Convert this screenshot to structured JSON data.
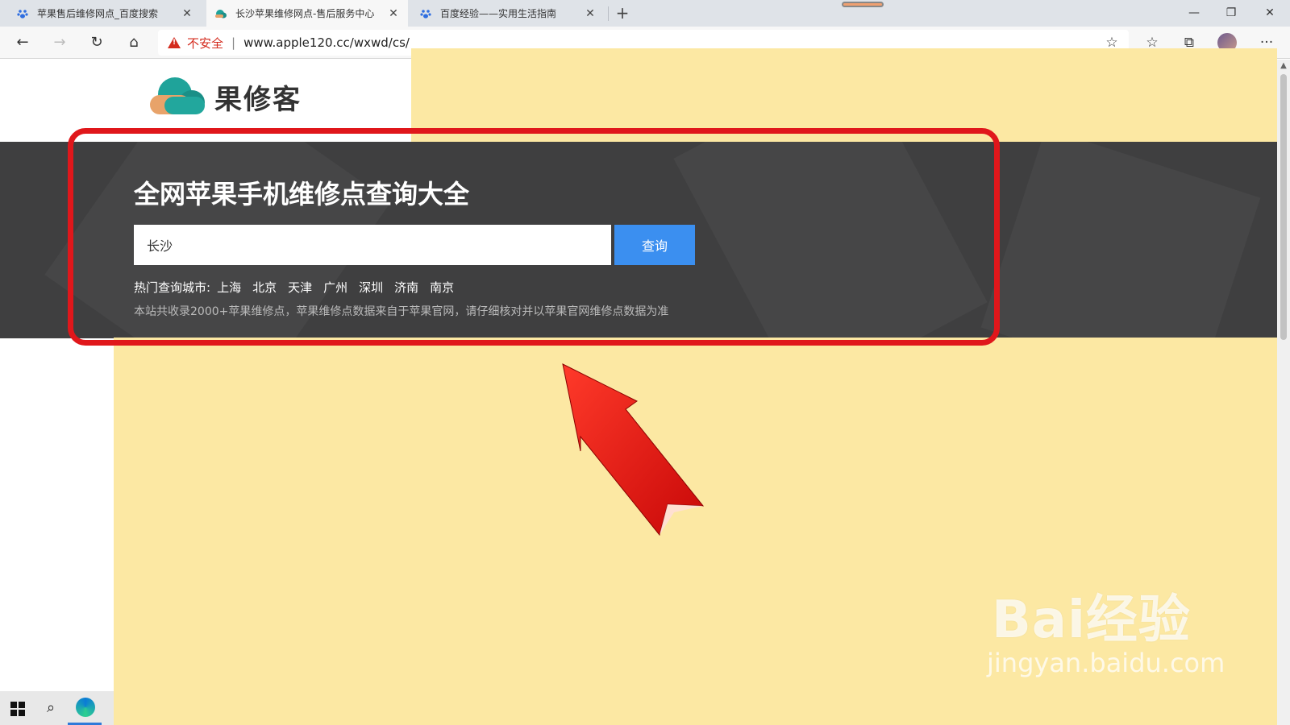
{
  "browser": {
    "tabs": [
      {
        "title": "苹果售后维修网点_百度搜索",
        "active": false,
        "favicon": "baidu-paw-icon"
      },
      {
        "title": "长沙苹果维修网点-售后服务中心",
        "active": true,
        "favicon": "cloud-icon"
      },
      {
        "title": "百度经验——实用生活指南",
        "active": false,
        "favicon": "baidu-paw-icon"
      }
    ],
    "new_tab": "+",
    "window_controls": {
      "minimize": "—",
      "restore": "❐",
      "close": "✕"
    },
    "nav": {
      "back": "←",
      "forward": "→",
      "refresh": "↻",
      "home": "⌂"
    },
    "address": {
      "security_label": "不安全",
      "separator": "|",
      "url": "www.apple120.cc/wxwd/cs/"
    },
    "toolbar_icons": {
      "star": "☆",
      "favorites": "☆",
      "collections": "⧉",
      "more": "···"
    }
  },
  "site": {
    "logo_text": "果修客",
    "hero_title": "全网苹果手机维修点查询大全",
    "search": {
      "value": "长沙",
      "button_label": "查询"
    },
    "hot_cities_label": "热门查询城市:",
    "hot_cities": [
      "上海",
      "北京",
      "天津",
      "广州",
      "深圳",
      "济南",
      "南京"
    ],
    "notice": "本站共收录2000+苹果维修点，苹果维修点数据来自于苹果官网，请仔细核对并以苹果官网维修点数据为准"
  },
  "watermark": {
    "main": "Bai经验",
    "sub": "jingyan.baidu.com"
  },
  "colors": {
    "accent_button": "#3b8ff0",
    "highlight_box": "#e0171b",
    "mask_yellow": "#fce8a3",
    "hero_bg": "#3f3f40"
  }
}
